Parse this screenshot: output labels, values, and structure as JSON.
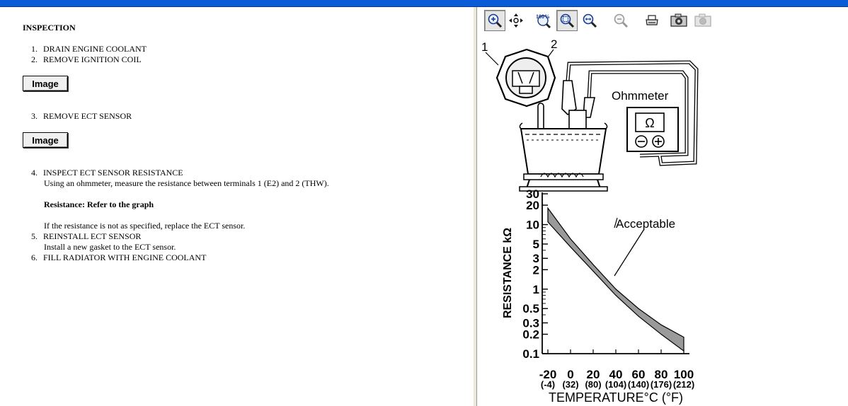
{
  "document": {
    "heading": "INSPECTION",
    "steps": [
      {
        "num": "1.",
        "text": "DRAIN ENGINE COOLANT"
      },
      {
        "num": "2.",
        "text": "REMOVE IGNITION COIL"
      },
      {
        "num": "3.",
        "text": "REMOVE ECT SENSOR"
      },
      {
        "num": "4.",
        "text": "INSPECT ECT SENSOR RESISTANCE"
      },
      {
        "num": "5.",
        "text": "REINSTALL ECT SENSOR"
      },
      {
        "num": "6.",
        "text": "FILL RADIATOR WITH ENGINE COOLANT"
      }
    ],
    "image_button_label": "Image",
    "step4_detail": "Using an ohmmeter, measure the resistance between terminals 1 (E2) and 2 (THW).",
    "step4_resistance": "Resistance: Refer to the graph",
    "step4_note": "If the resistance is not as specified, replace the ECT sensor.",
    "step5_detail": "Install a new gasket to the ECT sensor."
  },
  "toolbar": {
    "buttons": [
      {
        "name": "zoom-in-icon",
        "pressed": true
      },
      {
        "name": "pan-icon",
        "pressed": false
      },
      {
        "name": "zoom-100-icon",
        "label": "100%",
        "pressed": false
      },
      {
        "name": "zoom-fit-icon",
        "pressed": true
      },
      {
        "name": "zoom-width-icon",
        "pressed": false
      },
      {
        "name": "zoom-out-icon",
        "pressed": false
      },
      {
        "name": "print-icon",
        "pressed": false
      },
      {
        "name": "camera-icon",
        "pressed": false
      },
      {
        "name": "camera-disabled-icon",
        "pressed": false
      }
    ]
  },
  "figure": {
    "label_terminal_1": "1",
    "label_terminal_2": "2",
    "label_ohmmeter": "Ohmmeter",
    "omega_symbol": "Ω"
  },
  "chart_data": {
    "type": "area",
    "ylabel": "RESISTANCE kΩ",
    "xlabel": "TEMPERATURE°C (°F)",
    "annotation": "Acceptable",
    "y_scale": "log",
    "ylim": [
      0.1,
      30
    ],
    "xlim": [
      -20,
      100
    ],
    "y_ticks": [
      "0.1",
      "0.2",
      "0.3",
      "0.5",
      "1",
      "2",
      "3",
      "5",
      "10",
      "20",
      "30"
    ],
    "y_tick_values": [
      0.1,
      0.2,
      0.3,
      0.5,
      1,
      2,
      3,
      5,
      10,
      20,
      30
    ],
    "x_ticks_c": [
      "-20",
      "0",
      "20",
      "40",
      "60",
      "80",
      "100"
    ],
    "x_ticks_f": [
      "(-4)",
      "(32)",
      "(80)",
      "(104)",
      "(140)",
      "(176)",
      "(212)"
    ],
    "x_tick_values": [
      -20,
      0,
      20,
      40,
      60,
      80,
      100
    ],
    "series": [
      {
        "x": [
          -20,
          0,
          20,
          40,
          60,
          80,
          100
        ],
        "values": [
          18,
          6,
          2.4,
          1.0,
          0.5,
          0.28,
          0.18
        ]
      },
      {
        "x": [
          -20,
          0,
          20,
          40,
          60,
          80,
          100
        ],
        "values": [
          11,
          4.5,
          1.9,
          0.8,
          0.38,
          0.2,
          0.11
        ]
      }
    ],
    "grid": false
  }
}
